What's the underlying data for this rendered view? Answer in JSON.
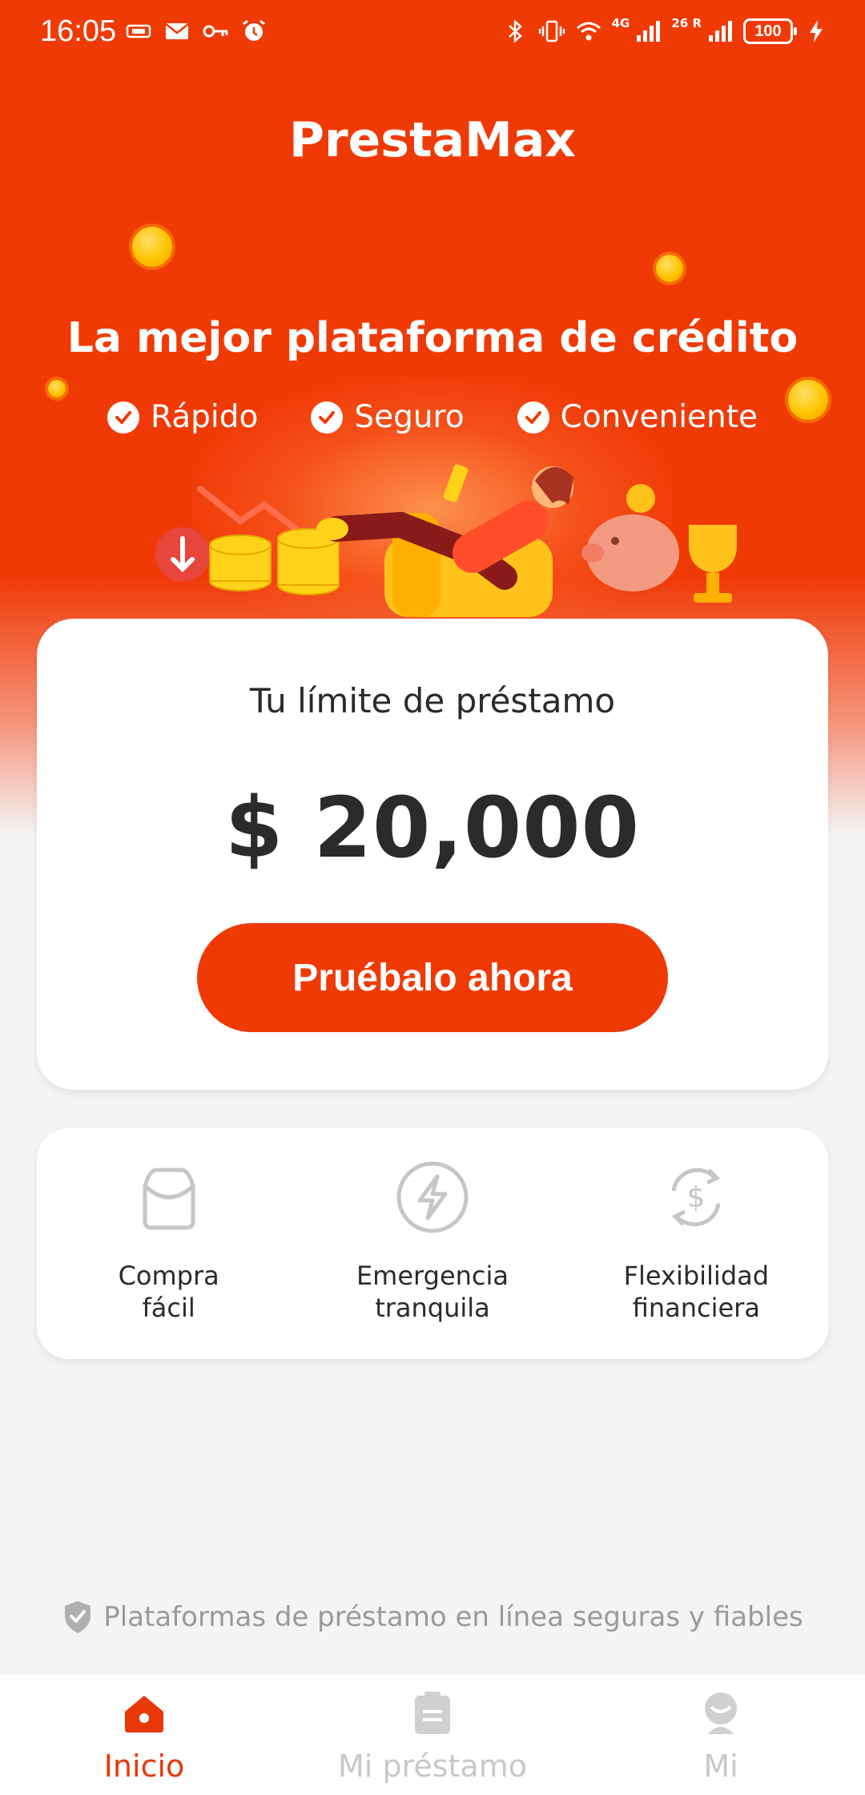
{
  "status_bar": {
    "time": "16:05",
    "battery": "100",
    "signal_1": "4G",
    "signal_2": "26 R"
  },
  "app": {
    "title": "PrestaMax",
    "tagline": "La mejor plataforma de crédito",
    "features": [
      "Rápido",
      "Seguro",
      "Conveniente"
    ]
  },
  "loan": {
    "label": "Tu límite de préstamo",
    "amount": "$ 20,000",
    "cta_label": "Pruébalo ahora"
  },
  "benefits": [
    {
      "icon": "shopping-bag-icon",
      "line1": "Compra",
      "line2": "fácil"
    },
    {
      "icon": "lightning-icon",
      "line1": "Emergencia",
      "line2": "tranquila"
    },
    {
      "icon": "dollar-refresh-icon",
      "line1": "Flexibilidad",
      "line2": "financiera"
    }
  ],
  "secure_note": "Plataformas de préstamo en línea seguras y fiables",
  "nav": [
    {
      "label": "Inicio",
      "icon": "home-icon",
      "active": true
    },
    {
      "label": "Mi préstamo",
      "icon": "clipboard-icon",
      "active": false
    },
    {
      "label": "Mi",
      "icon": "profile-icon",
      "active": false
    }
  ],
  "colors": {
    "brand": "#f03a06",
    "active_nav": "#e8380a",
    "inactive": "#c8c8c8",
    "text_dark": "#2b2b2b"
  }
}
